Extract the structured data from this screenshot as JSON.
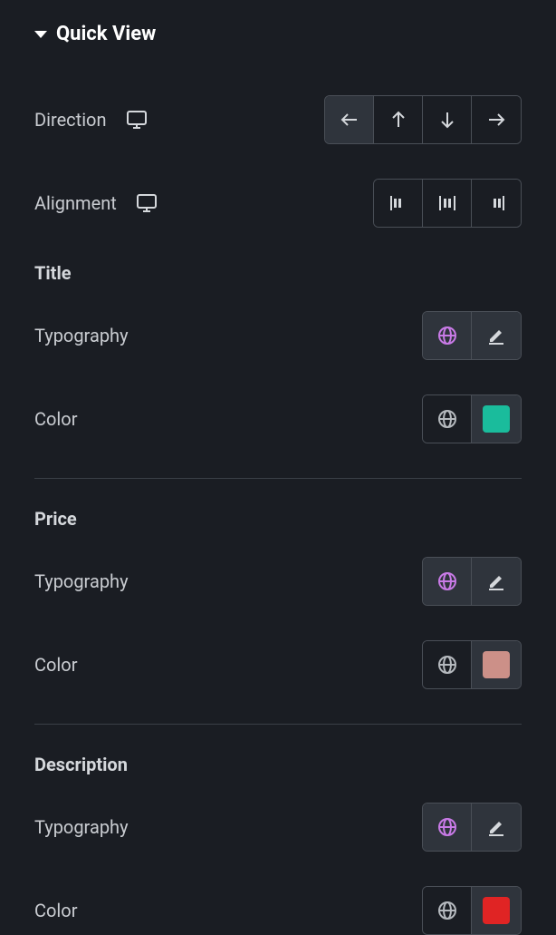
{
  "section": {
    "title": "Quick View"
  },
  "rows": {
    "direction": {
      "label": "Direction"
    },
    "alignment": {
      "label": "Alignment"
    }
  },
  "groups": {
    "title": {
      "heading": "Title",
      "typography_label": "Typography",
      "color_label": "Color",
      "color_swatch": "#1abc9c"
    },
    "price": {
      "heading": "Price",
      "typography_label": "Typography",
      "color_label": "Color",
      "color_swatch": "#cc9088"
    },
    "description": {
      "heading": "Description",
      "typography_label": "Typography",
      "color_label": "Color",
      "color_swatch": "#e02424"
    }
  }
}
